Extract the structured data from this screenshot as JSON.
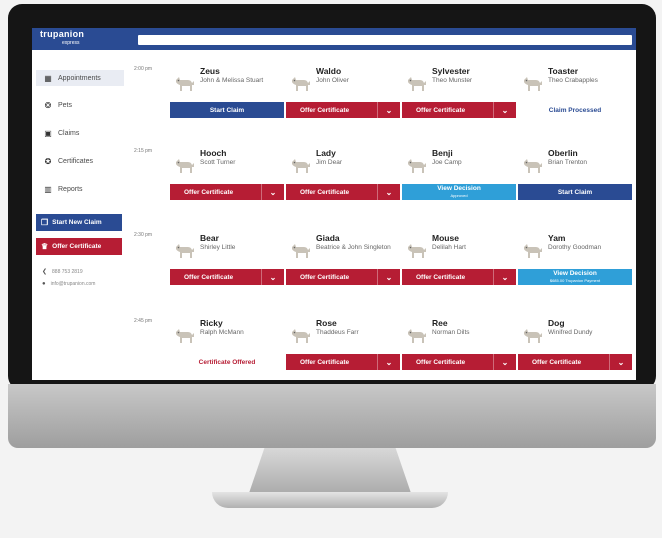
{
  "app": {
    "logo_line1": "trupanion",
    "logo_line2": "express"
  },
  "sidebar": {
    "items": [
      {
        "label": "Appointments",
        "icon": "calendar-icon"
      },
      {
        "label": "Pets",
        "icon": "paw-icon"
      },
      {
        "label": "Claims",
        "icon": "clipboard-icon"
      },
      {
        "label": "Certificates",
        "icon": "ribbon-icon"
      },
      {
        "label": "Reports",
        "icon": "chart-icon"
      }
    ],
    "start_claim_label": "Start New Claim",
    "offer_certificate_label": "Offer Certificate",
    "phone": "888 753 2819",
    "contact": "info@trupanion.com"
  },
  "schedule": {
    "times": [
      "2:00 pm",
      "2:15 pm",
      "2:30 pm",
      "2:45 pm"
    ],
    "rows": [
      [
        {
          "pet": "Zeus",
          "owner": "John & Melissa Stuart",
          "action": "Start Claim",
          "style": "navy"
        },
        {
          "pet": "Waldo",
          "owner": "John Oliver",
          "action": "Offer Certificate",
          "style": "red"
        },
        {
          "pet": "Sylvester",
          "owner": "Theo Munster",
          "action": "Offer Certificate",
          "style": "red"
        },
        {
          "pet": "Toaster",
          "owner": "Theo Crabapples",
          "action": "Claim Processed",
          "style": "textlink"
        }
      ],
      [
        {
          "pet": "Hooch",
          "owner": "Scott Turner",
          "action": "Offer Certificate",
          "style": "red"
        },
        {
          "pet": "Lady",
          "owner": "Jim Dear",
          "action": "Offer Certificate",
          "style": "red"
        },
        {
          "pet": "Benji",
          "owner": "Joe Camp",
          "action": "View Decision",
          "sub": "Approved",
          "style": "light"
        },
        {
          "pet": "Oberlin",
          "owner": "Brian Trenton",
          "action": "Start Claim",
          "style": "navy"
        }
      ],
      [
        {
          "pet": "Bear",
          "owner": "Shirley Little",
          "action": "Offer Certificate",
          "style": "red"
        },
        {
          "pet": "Giada",
          "owner": "Beatrice & John Singleton",
          "action": "Offer Certificate",
          "style": "red"
        },
        {
          "pet": "Mouse",
          "owner": "Delilah Hart",
          "action": "Offer Certificate",
          "style": "red"
        },
        {
          "pet": "Yam",
          "owner": "Dorothy Goodman",
          "action": "View Decision",
          "sub": "$685.00 Trupanion Payment",
          "style": "light"
        }
      ],
      [
        {
          "pet": "Ricky",
          "owner": "Ralph McMann",
          "action": "Certificate Offered",
          "style": "textlink pink"
        },
        {
          "pet": "Rose",
          "owner": "Thaddeus Farr",
          "action": "Offer Certificate",
          "style": "red"
        },
        {
          "pet": "Ree",
          "owner": "Norman Dilts",
          "action": "Offer Certificate",
          "style": "red"
        },
        {
          "pet": "Dog",
          "owner": "Winifred Dundy",
          "action": "Offer Certificate",
          "style": "red"
        }
      ]
    ]
  },
  "colors": {
    "brand_blue": "#2a4b93",
    "brand_red": "#b61d34",
    "decision_blue": "#2f9fd8"
  }
}
